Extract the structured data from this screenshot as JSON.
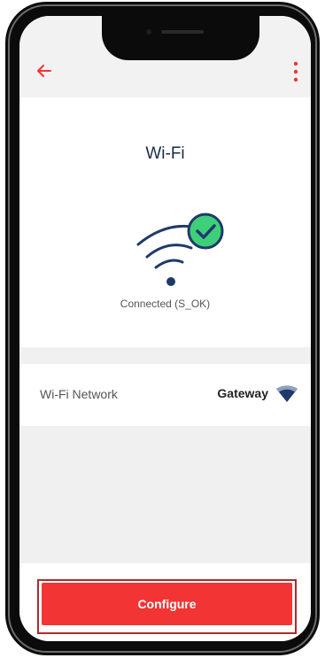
{
  "appbar": {
    "back_icon": "arrow-left-icon",
    "menu_icon": "more-vertical-icon"
  },
  "main": {
    "title": "Wi-Fi",
    "status_icon": "wifi-connected-icon",
    "status_text": "Connected (S_OK)"
  },
  "network_row": {
    "label": "Wi-Fi Network",
    "value": "Gateway",
    "icon": "wifi-signal-icon"
  },
  "footer": {
    "configure_label": "Configure"
  },
  "colors": {
    "accent": "#f23434",
    "dark_blue": "#1f3a6a",
    "check_green": "#3fcf7a"
  }
}
